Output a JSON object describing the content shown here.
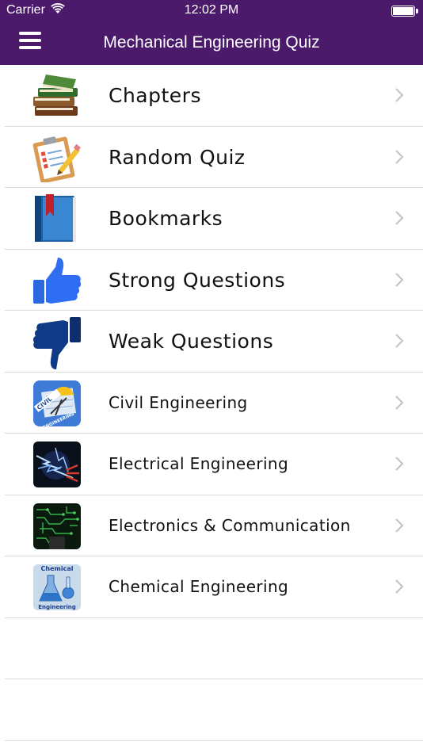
{
  "statusbar": {
    "carrier": "Carrier",
    "time": "12:02 PM",
    "battery_level": 1.0
  },
  "navbar": {
    "title": "Mechanical Engineering Quiz",
    "menu_icon": "hamburger-menu-icon",
    "background_color": "#4b1a6b"
  },
  "menu": {
    "items": [
      {
        "label": "Chapters",
        "icon": "books-icon"
      },
      {
        "label": "Random Quiz",
        "icon": "clipboard-pencil-icon"
      },
      {
        "label": "Bookmarks",
        "icon": "bookmark-book-icon"
      },
      {
        "label": "Strong Questions",
        "icon": "thumbs-up-icon"
      },
      {
        "label": "Weak Questions",
        "icon": "thumbs-down-icon"
      },
      {
        "label": "Civil Engineering",
        "icon": "civil-engineering-app-icon"
      },
      {
        "label": "Electrical Engineering",
        "icon": "electrical-engineering-app-icon"
      },
      {
        "label": "Electronics & Communication",
        "icon": "electronics-circuit-app-icon"
      },
      {
        "label": "Chemical Engineering",
        "icon": "chemical-engineering-app-icon"
      }
    ]
  },
  "app_icons": {
    "civil_badge": "CIVIL",
    "civil_caption": "ENGINEERING",
    "chemical_top": "Chemical",
    "chemical_bottom": "Engineering"
  }
}
